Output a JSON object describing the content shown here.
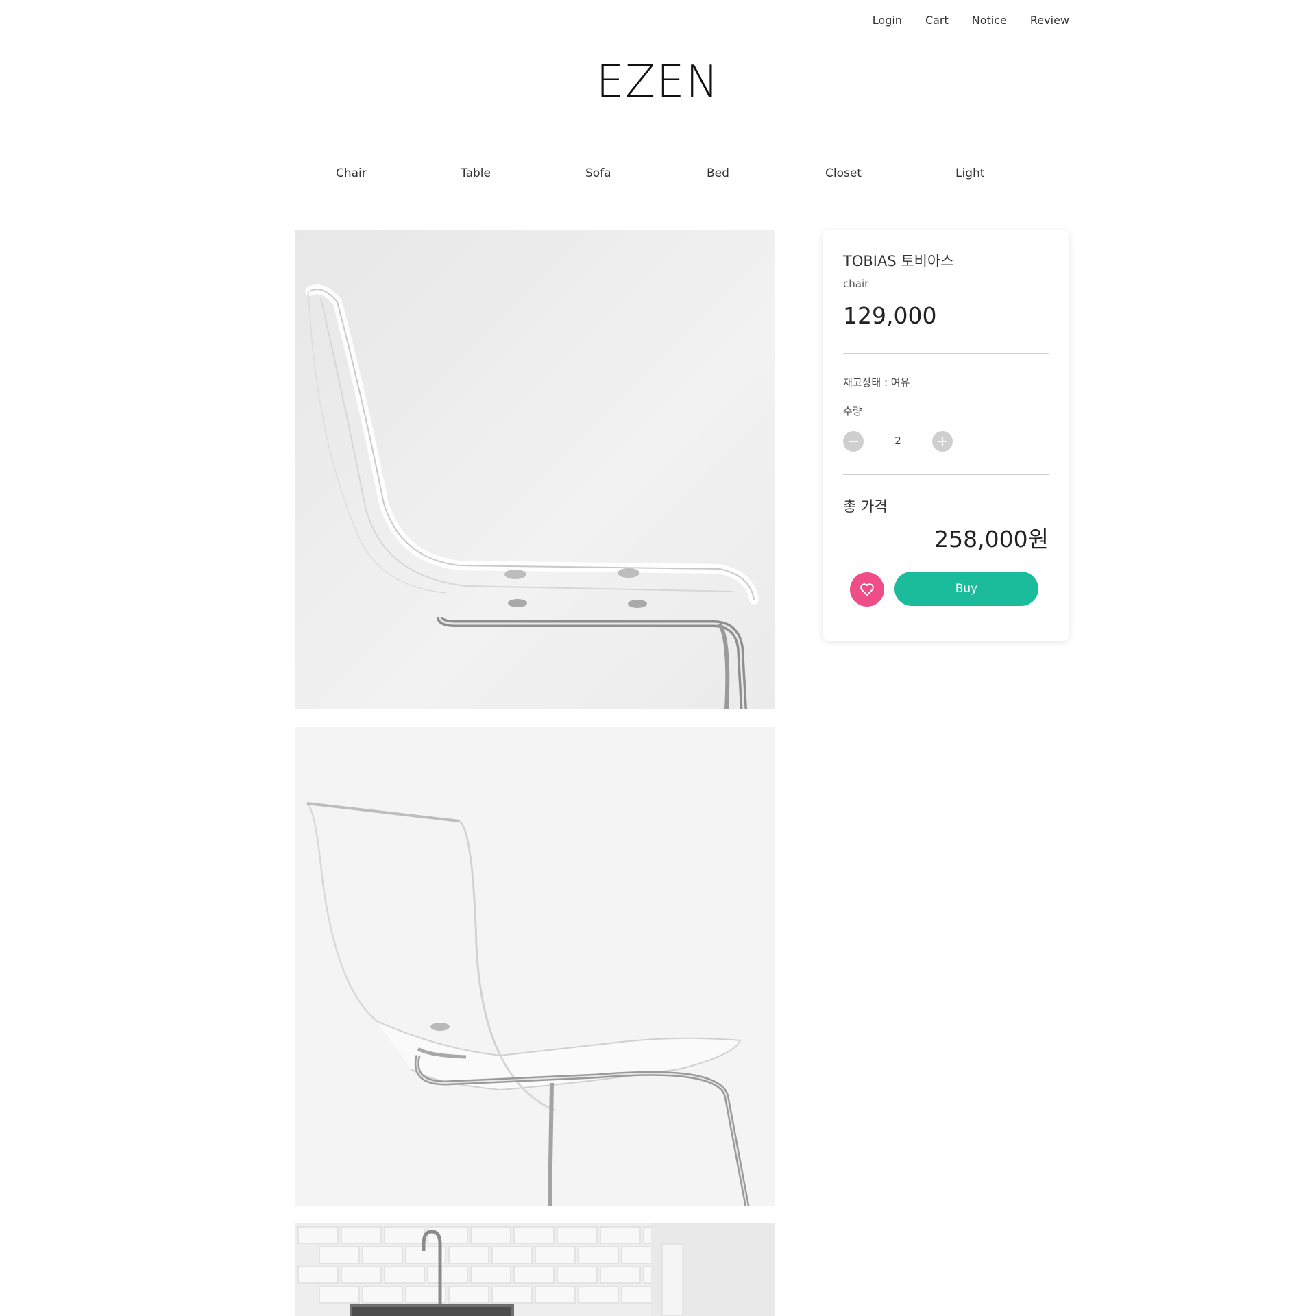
{
  "header": {
    "util_nav": [
      "Login",
      "Cart",
      "Notice",
      "Review"
    ],
    "logo": "EZEN"
  },
  "categories": [
    "Chair",
    "Table",
    "Sofa",
    "Bed",
    "Closet",
    "Light"
  ],
  "product": {
    "name": "TOBIAS 토비아스",
    "category": "chair",
    "price": "129,000",
    "stock_status": "재고상태 : 여유",
    "quantity_label": "수량",
    "quantity": "2",
    "total_label": "총 가격",
    "total": "258,000원",
    "buy_label": "Buy"
  },
  "colors": {
    "accent": "#1bbc9b",
    "like": "#ef4d87",
    "qty_button": "#cfcfcf"
  },
  "icons": [
    "heart-icon",
    "minus-icon",
    "plus-icon"
  ]
}
